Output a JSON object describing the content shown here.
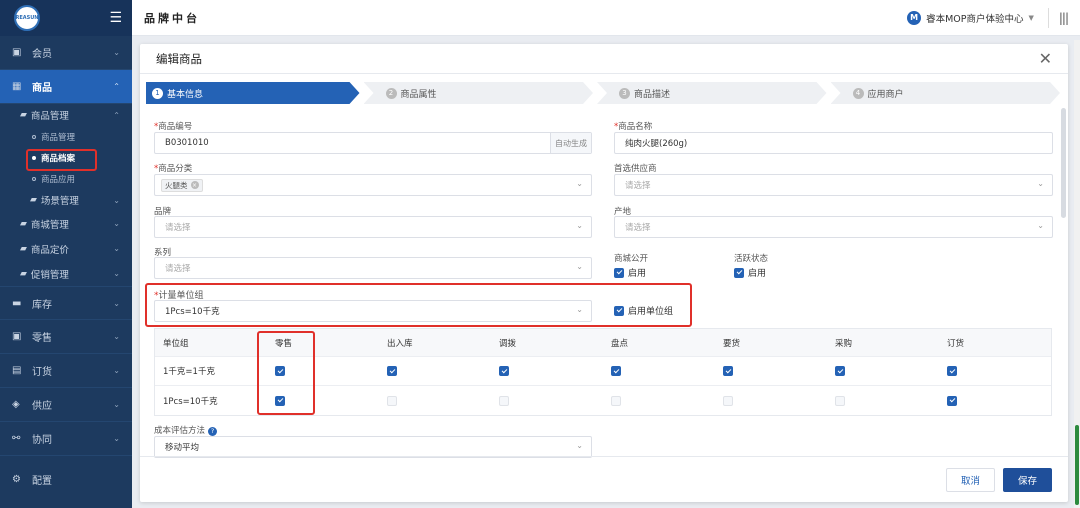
{
  "sidebar": {
    "logo_text": "REASUN",
    "items": [
      {
        "label": "会员"
      },
      {
        "label": "商品"
      },
      {
        "label": "库存"
      },
      {
        "label": "零售"
      },
      {
        "label": "订货"
      },
      {
        "label": "供应"
      },
      {
        "label": "协同"
      },
      {
        "label": "配置"
      }
    ],
    "sub": {
      "goods_mgmt": "商品管理",
      "goods_mgmt_leaf": "商品管理",
      "goods_archive": "商品档案",
      "goods_apply": "商品应用",
      "scene_mgmt": "场景管理",
      "mall_mgmt": "商城管理",
      "goods_pricing": "商品定价",
      "promo_mgmt": "促销管理"
    }
  },
  "header": {
    "title": "品牌中台",
    "tenant_badge": "M",
    "tenant": "睿本MOP商户体验中心"
  },
  "modal": {
    "title": "编辑商品",
    "steps": [
      {
        "num": "1",
        "label": "基本信息"
      },
      {
        "num": "2",
        "label": "商品属性"
      },
      {
        "num": "3",
        "label": "商品描述"
      },
      {
        "num": "4",
        "label": "应用商户"
      }
    ],
    "fields": {
      "code_label": "商品编号",
      "code_value": "B0301010",
      "code_suffix": "自动生成",
      "name_label": "商品名称",
      "name_value": "纯肉火腿(260g)",
      "category_label": "商品分类",
      "category_tag": "火腿类",
      "supplier_label": "首选供应商",
      "supplier_placeholder": "请选择",
      "brand_label": "品牌",
      "brand_placeholder": "请选择",
      "origin_label": "产地",
      "origin_placeholder": "请选择",
      "series_label": "系列",
      "series_placeholder": "请选择",
      "mall_public_label": "商城公开",
      "mall_public_check": "启用",
      "active_label": "活跃状态",
      "active_check": "启用",
      "unit_group_label": "计量单位组",
      "unit_group_value": "1Pcs=10千克",
      "enable_unit_group": "启用单位组",
      "cost_label": "成本评估方法",
      "cost_value": "移动平均"
    },
    "table": {
      "headers": [
        "单位组",
        "零售",
        "出入库",
        "调拨",
        "盘点",
        "要货",
        "采购",
        "订货"
      ],
      "rows": [
        {
          "name": "1千克=1千克",
          "checks": [
            "on",
            "on",
            "on",
            "on",
            "on",
            "on",
            "on"
          ]
        },
        {
          "name": "1Pcs=10千克",
          "checks": [
            "on",
            "dis",
            "dis",
            "dis",
            "dis",
            "dis",
            "on"
          ]
        }
      ]
    },
    "buttons": {
      "cancel": "取消",
      "save": "保存"
    }
  },
  "colors": {
    "primary": "#2462b5",
    "sidebar": "#1d3a5f",
    "highlight": "#e0302a"
  }
}
